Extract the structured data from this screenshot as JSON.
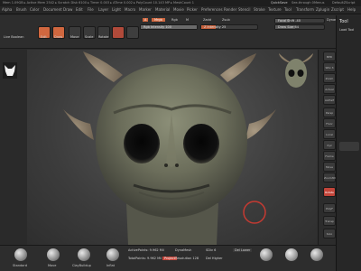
{
  "title_bar": {
    "status_text": "Mem 1.09GB ▸ Active Mem 2542 ▸ Scratch Disk 6100 ▸ Timer 0.003 ▸ ATime 0.002 ▸ PolyCount 10.143 MP ▸ MeshCount 1",
    "quicksave": "QuickSave",
    "see_through": "See-through 0",
    "menus_label": "Menus",
    "default_zscript": "DefaultZScript"
  },
  "menubar": {
    "items": [
      "Alpha",
      "Brush",
      "Color",
      "Document",
      "Draw",
      "Edit",
      "File",
      "Layer",
      "Light",
      "Macro",
      "Marker",
      "Material",
      "Movie",
      "Picker",
      "Preferences",
      "Render",
      "Stencil",
      "Stroke",
      "Texture",
      "Tool",
      "Transform",
      "Zplugin",
      "Zscript",
      "Help"
    ]
  },
  "shelf": {
    "live_boolean": "Live Boolean",
    "edit_label": "Edit",
    "draw_label": "Draw",
    "move_label": "Move",
    "scale_label": "Scale",
    "rotate_label": "Rotate",
    "a_label": "A",
    "mrgb_label": "Mrgb",
    "rgb_label": "Rgb",
    "m_label": "M",
    "zadd_label": "Zadd",
    "zsub_label": "Zsub",
    "rgb_intensity": "Rgb Intensity 100",
    "z_intensity": "Z Intensity 25",
    "focal_shift": "Focal Shift -40",
    "draw_size": "Draw Size 64",
    "dynamic": "Dynamic"
  },
  "right_shelf": {
    "bpr": "BPR",
    "spix": "SPix 3",
    "zoom": "Zoom",
    "actual": "Actual",
    "aahalf": "AAHalf",
    "persp": "Persp",
    "floor": "Floor",
    "local": "Local",
    "xyz": "Xyz",
    "frame": "Frame",
    "move": "Move",
    "zoom3d": "Zoom3D",
    "rotate": "Rotate",
    "polyf": "PolyF",
    "transp": "Transp",
    "solo": "Solo"
  },
  "tray": {
    "tool_label": "Tool",
    "load_tool": "Load Tool"
  },
  "bottombar": {
    "brushes": [
      "Standard",
      "Move",
      "ClayBuildup",
      "Inflat",
      "",
      "",
      "",
      ""
    ],
    "active_points": "ActivePoints: 9.962 Mil",
    "total_points": "TotalPoints: 9.962 Mil",
    "sdiv": "SDiv 6",
    "del_lower": "Del Lower",
    "del_higher": "Del Higher",
    "dynamesh": "DynaMesh",
    "resolution": "Resolution 128",
    "project": "Project"
  },
  "colors": {
    "accent": "#d0673f",
    "red_button": "#c2453a"
  }
}
